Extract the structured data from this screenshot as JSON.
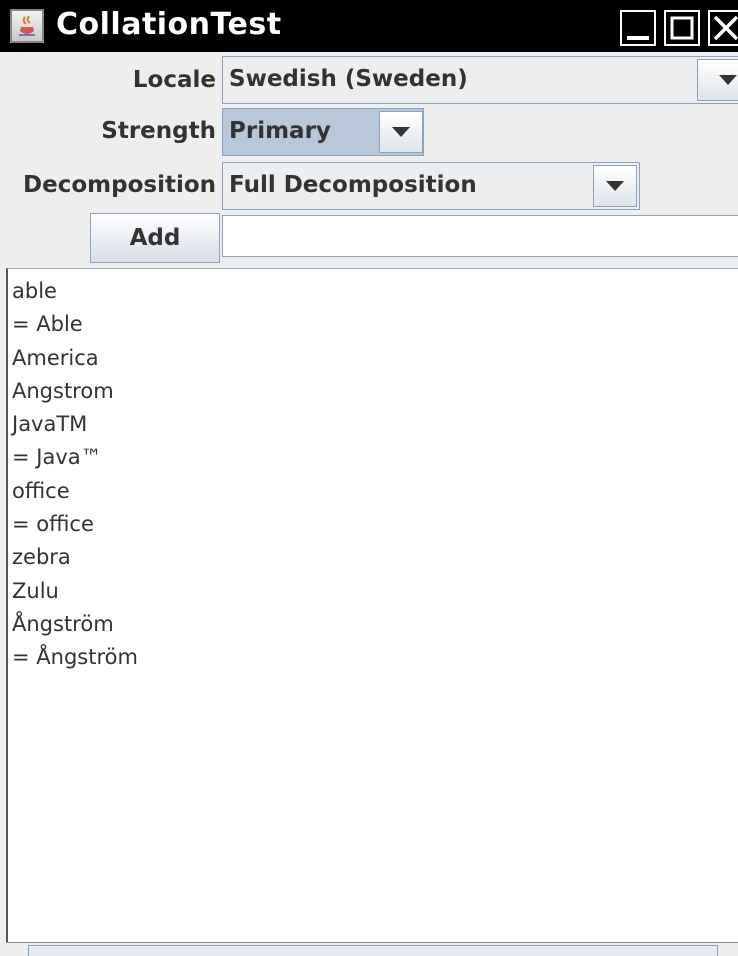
{
  "window": {
    "title": "CollationTest",
    "icon": "java-cup-icon",
    "controls": [
      "minimize-icon",
      "maximize-icon",
      "close-icon"
    ]
  },
  "form": {
    "locale": {
      "label": "Locale",
      "value": "Swedish (Sweden)"
    },
    "strength": {
      "label": "Strength",
      "value": "Primary"
    },
    "decomposition": {
      "label": "Decomposition",
      "value": "Full Decomposition"
    },
    "add": {
      "label": "Add",
      "input_value": ""
    }
  },
  "list": {
    "items": [
      "able",
      "= Able",
      "America",
      "Angstrom",
      "JavaTM",
      "= Java™",
      "office",
      "= office",
      "zebra",
      "Zulu",
      "Ångström",
      "= Ångström"
    ]
  },
  "colors": {
    "titlebar": "#000000",
    "control_border": "#8aa2bd",
    "selected_combo": "#b8c7d9",
    "text": "#333333"
  }
}
